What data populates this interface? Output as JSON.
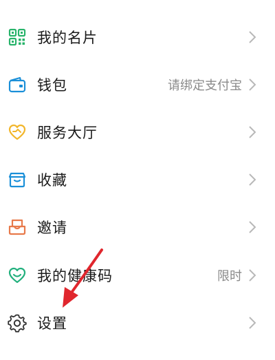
{
  "menu": {
    "items": [
      {
        "label": "我的名片",
        "hint": "",
        "icon": "qr-code-icon",
        "color": "#27b36a"
      },
      {
        "label": "钱包",
        "hint": "请绑定支付宝",
        "icon": "wallet-icon",
        "color": "#1a8fd8"
      },
      {
        "label": "服务大厅",
        "hint": "",
        "icon": "heart-handshake-icon",
        "color": "#f2b62b"
      },
      {
        "label": "收藏",
        "hint": "",
        "icon": "box-icon",
        "color": "#1a8fd8"
      },
      {
        "label": "邀请",
        "hint": "",
        "icon": "inbox-icon",
        "color": "#e8794a"
      },
      {
        "label": "我的健康码",
        "hint": "限时",
        "icon": "health-heart-icon",
        "color": "#22b07d"
      },
      {
        "label": "设置",
        "hint": "",
        "icon": "gear-icon",
        "color": "#333333"
      }
    ]
  },
  "annotation": {
    "arrow_color": "#e0262d"
  }
}
